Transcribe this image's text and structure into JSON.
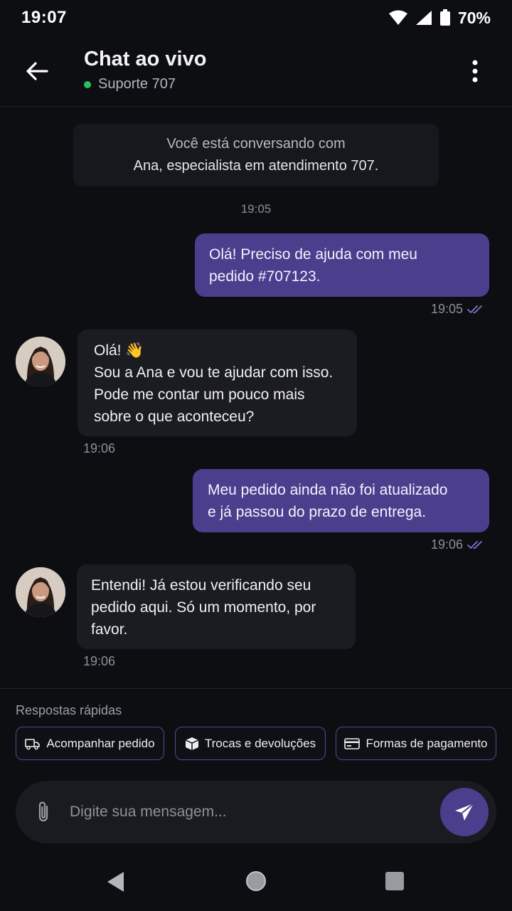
{
  "status_bar": {
    "time": "19:07",
    "battery": "70%"
  },
  "header": {
    "title": "Chat ao vivo",
    "subtitle": "Suporte 707"
  },
  "system_message": {
    "line1": "Você está conversando com",
    "line2": "Ana, especialista em atendimento 707.",
    "time": "19:05"
  },
  "messages": [
    {
      "from": "user",
      "lines": [
        "Olá! Preciso de ajuda com meu",
        "pedido #707123."
      ],
      "time": "19:05"
    },
    {
      "from": "agent",
      "lines": [
        "Olá! 👋",
        "Sou a Ana e vou te ajudar com isso.",
        "Pode me contar um pouco mais",
        "sobre o que aconteceu?"
      ],
      "time": "19:06"
    },
    {
      "from": "user",
      "lines": [
        "Meu pedido ainda não foi atualizado",
        "e já passou do prazo de entrega."
      ],
      "time": "19:06"
    },
    {
      "from": "agent",
      "lines": [
        "Entendi! Já estou verificando seu",
        "pedido aqui. Só um momento, por",
        "favor."
      ],
      "time": "19:06"
    }
  ],
  "quick_replies": {
    "label": "Respostas rápidas",
    "items": [
      {
        "label": "Acompanhar pedido",
        "icon": "truck-icon"
      },
      {
        "label": "Trocas e devoluções",
        "icon": "box-icon"
      },
      {
        "label": "Formas de pagamento",
        "icon": "credit-card-icon"
      }
    ]
  },
  "composer": {
    "placeholder": "Digite sua mensagem..."
  },
  "colors": {
    "accent": "#4b3f8d",
    "background": "#0d0e12",
    "online": "#2fbf5a",
    "bubble_in": "#1b1c22"
  }
}
